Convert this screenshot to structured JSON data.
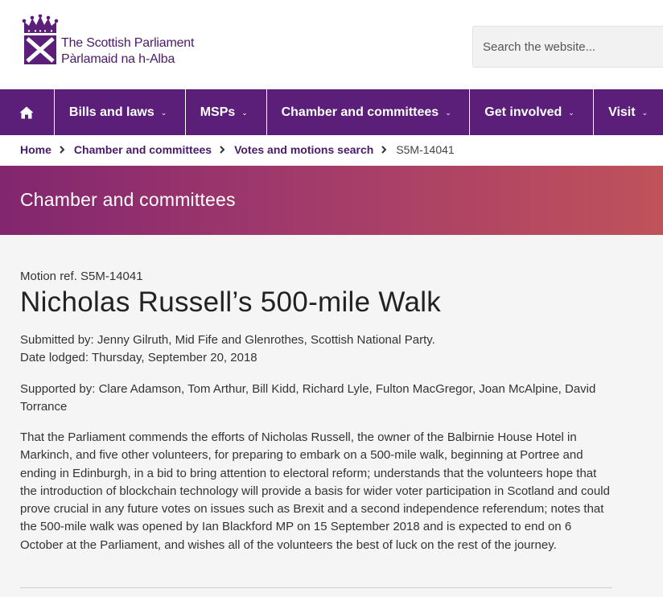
{
  "header": {
    "logo_line1": "The Scottish Parliament",
    "logo_line2": "Pàrlamaid na h-Alba",
    "search_placeholder": "Search the website..."
  },
  "nav": {
    "home_icon": "home-icon",
    "items": [
      {
        "label": "Bills and laws"
      },
      {
        "label": "MSPs"
      },
      {
        "label": "Chamber and committees"
      },
      {
        "label": "Get involved"
      },
      {
        "label": "Visit"
      }
    ]
  },
  "breadcrumb": {
    "items": [
      {
        "label": "Home"
      },
      {
        "label": "Chamber and committees"
      },
      {
        "label": "Votes and motions search"
      }
    ],
    "current": "S5M-14041"
  },
  "banner": {
    "title": "Chamber and committees"
  },
  "motion": {
    "ref": "Motion ref. S5M-14041",
    "title": "Nicholas Russell’s 500-mile Walk",
    "submitted_by": "Submitted by: Jenny Gilruth, Mid Fife and Glenrothes, Scottish National Party.",
    "date_lodged": "Date lodged: Thursday, September 20, 2018",
    "supported_by": "Supported by: Clare Adamson, Tom Arthur, Bill Kidd, Richard Lyle, Fulton MacGregor, Joan McAlpine, David Torrance",
    "text": "That the Parliament commends the efforts of Nicholas Russell, the owner of the Balbirnie House Hotel in Markinch, and five other volunteers, for preparing to embark on a 500-mile walk, beginning at Portree and ending in Edinburgh, in a bid to bring attention to electoral reform; understands that the volunteers hope that the introduction of blockchain technology will provide a basis for wider voter participation in Scotland and could prove crucial in any future votes on issues such as Brexit and a second independence referendum; notes that the 500-mile walk was opened by Ian Blackford MP on 15 September 2018 and is expected to end on 6 October at the Parliament, and wishes all of the volunteers the best of luck on the rest of the journey."
  },
  "colors": {
    "brand_purple": "#5b1f7a",
    "banner_start": "#82266f",
    "banner_end": "#c0525a"
  }
}
